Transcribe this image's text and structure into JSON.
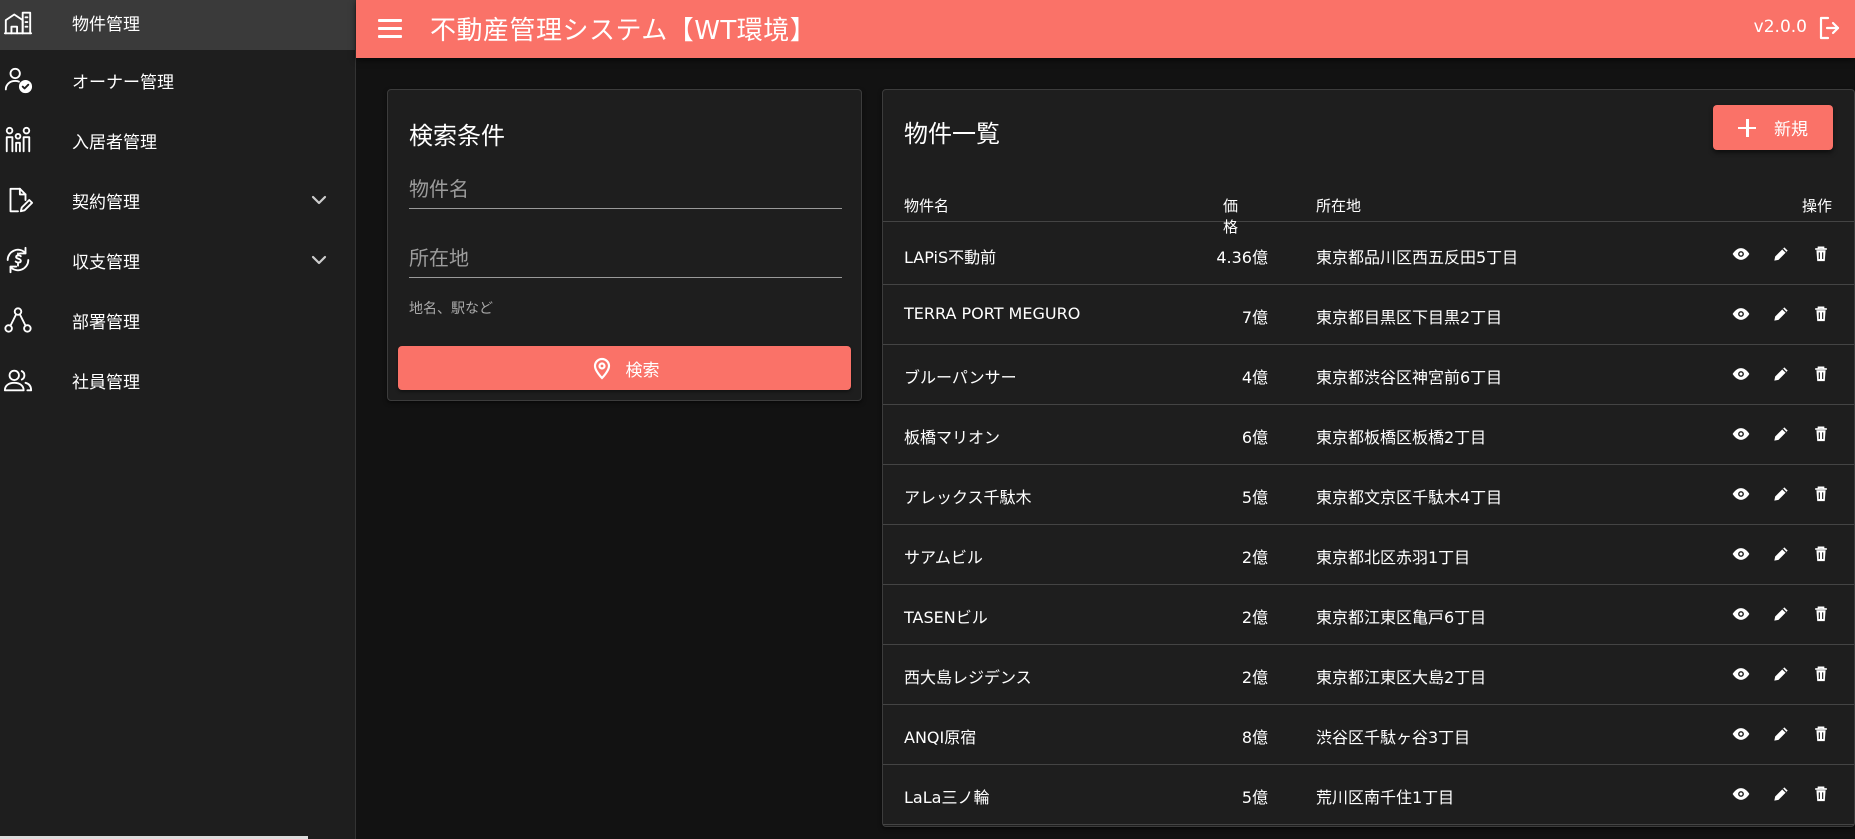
{
  "header": {
    "title": "不動産管理システム【WT環境】",
    "version": "v2.0.0"
  },
  "sidebar": {
    "items": [
      {
        "label": "物件管理",
        "icon": "building-icon",
        "active": true
      },
      {
        "label": "オーナー管理",
        "icon": "owner-check-icon"
      },
      {
        "label": "入居者管理",
        "icon": "family-icon"
      },
      {
        "label": "契約管理",
        "icon": "contract-edit-icon",
        "expandable": true
      },
      {
        "label": "収支管理",
        "icon": "currency-cycle-icon",
        "expandable": true
      },
      {
        "label": "部署管理",
        "icon": "hierarchy-icon"
      },
      {
        "label": "社員管理",
        "icon": "people-icon"
      }
    ]
  },
  "search": {
    "title": "検索条件",
    "name_placeholder": "物件名",
    "location_placeholder": "所在地",
    "location_hint": "地名、駅など",
    "button_label": "検索"
  },
  "list": {
    "title": "物件一覧",
    "new_label": "新規",
    "headers": {
      "name": "物件名",
      "price": "価格",
      "location": "所在地",
      "ops": "操作"
    },
    "rows": [
      {
        "name": "LAPiS不動前",
        "price": "4.36億",
        "location": "東京都品川区西五反田5丁目"
      },
      {
        "name": "TERRA PORT MEGURO",
        "price": "7億",
        "location": "東京都目黒区下目黒2丁目"
      },
      {
        "name": "ブルーパンサー",
        "price": "4億",
        "location": "東京都渋谷区神宮前6丁目"
      },
      {
        "name": "板橋マリオン",
        "price": "6億",
        "location": "東京都板橋区板橋2丁目"
      },
      {
        "name": "アレックス千駄木",
        "price": "5億",
        "location": "東京都文京区千駄木4丁目"
      },
      {
        "name": "サアムビル",
        "price": "2億",
        "location": "東京都北区赤羽1丁目"
      },
      {
        "name": "TASENビル",
        "price": "2億",
        "location": "東京都江東区亀戸6丁目"
      },
      {
        "name": "西大島レジデンス",
        "price": "2億",
        "location": "東京都江東区大島2丁目"
      },
      {
        "name": "ANQI原宿",
        "price": "8億",
        "location": "渋谷区千駄ヶ谷3丁目"
      },
      {
        "name": "LaLa三ノ輪",
        "price": "5億",
        "location": "荒川区南千住1丁目"
      }
    ]
  },
  "colors": {
    "accent": "#fa7268",
    "background": "#121212",
    "surface": "#1e1e1e",
    "sidebar_active": "#3a3a3a"
  }
}
